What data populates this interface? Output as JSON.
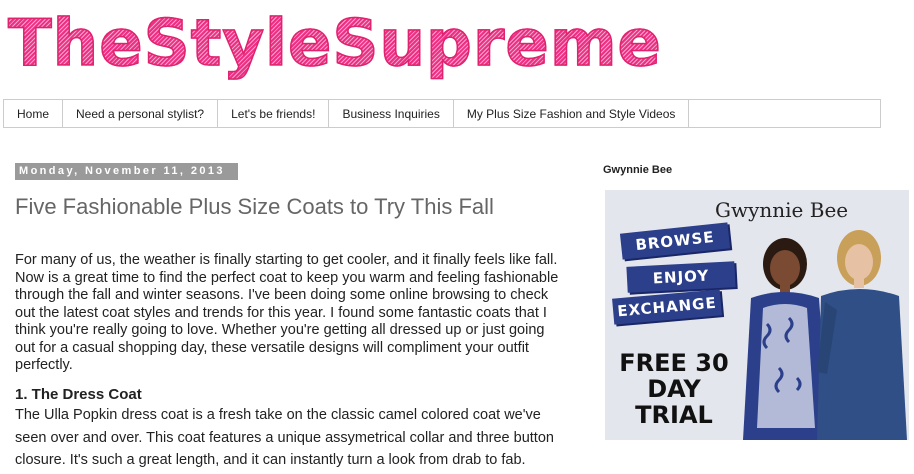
{
  "site": {
    "title": "TheStyleSupreme"
  },
  "nav": {
    "items": [
      "Home",
      "Need a personal stylist?",
      "Let's be friends!",
      "Business Inquiries",
      "My Plus Size Fashion and Style Videos"
    ]
  },
  "post": {
    "date": "Monday, November 11, 2013",
    "title": "Five Fashionable Plus Size Coats to Try This Fall",
    "intro": "For many of us, the weather is finally starting to get cooler, and it finally feels like fall. Now is a great time to find the perfect coat to keep you warm and feeling fashionable through the fall and winter seasons. I've been doing some online browsing to check out the latest coat styles and trends for this year. I found some fantastic coats that I think you're really going to love. Whether you're getting all dressed up or just going out for a casual shopping day, these versatile designs will compliment your outfit perfectly.",
    "section_heading": "1. The Dress Coat",
    "section_body": "The Ulla Popkin dress coat is a fresh take on the classic camel colored coat we've seen over and over. This coat features a unique assymetrical collar and three button closure. It's such a great length, and it can instantly turn a look from drab to fab."
  },
  "sidebar": {
    "widget_title": "Gwynnie Bee",
    "ad": {
      "brand": "Gwynnie Bee",
      "banners": [
        "BROWSE",
        "ENJOY",
        "EXCHANGE"
      ],
      "offer": "FREE 30 DAY TRIAL"
    }
  },
  "colors": {
    "brand_pink": "#ee2f86",
    "ad_navy": "#2c3f8a",
    "date_bg": "#9a9a9a"
  }
}
